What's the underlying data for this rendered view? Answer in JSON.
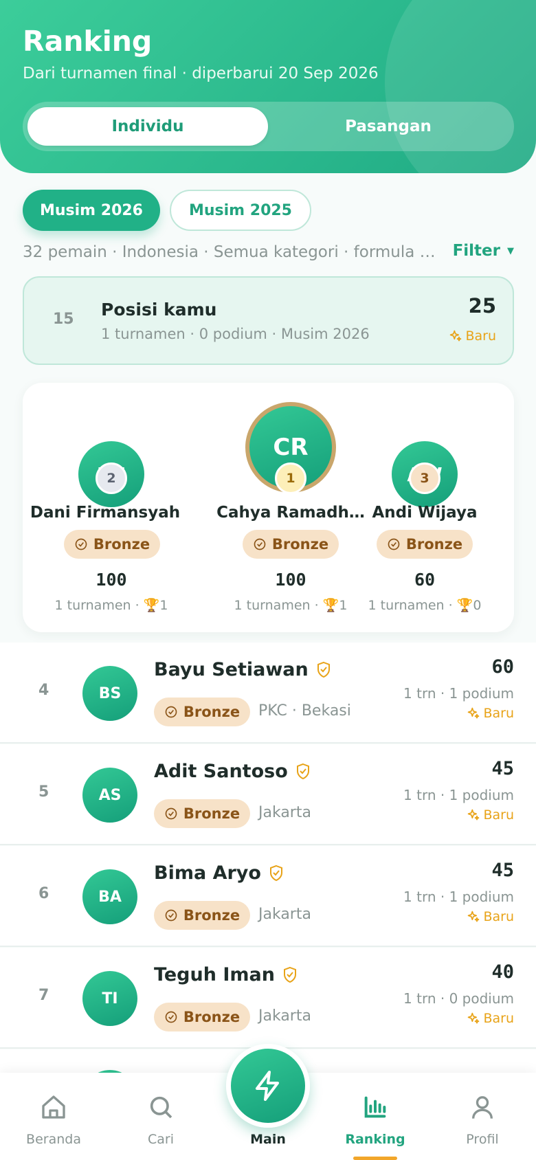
{
  "header": {
    "title": "Ranking",
    "subtitle": "Dari turnamen final · diperbarui 20 Sep 2026",
    "segments": [
      {
        "label": "Individu",
        "active": true
      },
      {
        "label": "Pasangan",
        "active": false
      }
    ]
  },
  "seasons": [
    {
      "label": "Musim 2026",
      "active": true
    },
    {
      "label": "Musim 2025",
      "active": false
    }
  ],
  "meta": {
    "summary": "32 pemain · Indonesia · Semua kategori · formula …",
    "filter_label": "Filter"
  },
  "my_position": {
    "rank": "15",
    "label": "Posisi kamu",
    "sub": "1 turnamen · 0 podium · Musim 2026",
    "score": "25",
    "badge": "Baru"
  },
  "podium": [
    {
      "initials": "DF",
      "rank": "2",
      "name": "Dani Firmansyah",
      "tier": "Bronze",
      "score": "100",
      "tournaments": "1 turnamen",
      "trophies": "1"
    },
    {
      "initials": "CR",
      "rank": "1",
      "name": "Cahya Ramadh…",
      "tier": "Bronze",
      "score": "100",
      "tournaments": "1 turnamen",
      "trophies": "1"
    },
    {
      "initials": "AW",
      "rank": "3",
      "name": "Andi Wijaya",
      "tier": "Bronze",
      "score": "60",
      "tournaments": "1 turnamen",
      "trophies": "0"
    }
  ],
  "rows": [
    {
      "rank": "4",
      "initials": "BS",
      "name": "Bayu Setiawan",
      "tier": "Bronze",
      "location": "PKC · Bekasi",
      "score": "60",
      "sub": "1 trn · 1 podium",
      "badge": "Baru"
    },
    {
      "rank": "5",
      "initials": "AS",
      "name": "Adit Santoso",
      "tier": "Bronze",
      "location": "Jakarta",
      "score": "45",
      "sub": "1 trn · 1 podium",
      "badge": "Baru"
    },
    {
      "rank": "6",
      "initials": "BA",
      "name": "Bima Aryo",
      "tier": "Bronze",
      "location": "Jakarta",
      "score": "45",
      "sub": "1 trn · 1 podium",
      "badge": "Baru"
    },
    {
      "rank": "7",
      "initials": "TI",
      "name": "Teguh Iman",
      "tier": "Bronze",
      "location": "Jakarta",
      "score": "40",
      "sub": "1 trn · 0 podium",
      "badge": "Baru"
    }
  ],
  "nav": {
    "items": [
      {
        "label": "Beranda",
        "icon": "home-icon"
      },
      {
        "label": "Cari",
        "icon": "search-icon"
      },
      {
        "label": "Main",
        "icon": "lightning-icon"
      },
      {
        "label": "Ranking",
        "icon": "bar-chart-icon"
      },
      {
        "label": "Profil",
        "icon": "user-icon"
      }
    ],
    "active": "Ranking"
  },
  "colors": {
    "primary": "#22a47f",
    "accent": "#f2a62a",
    "tier_bronze_bg": "#f7e2c8",
    "tier_bronze_text": "#8a5418"
  }
}
